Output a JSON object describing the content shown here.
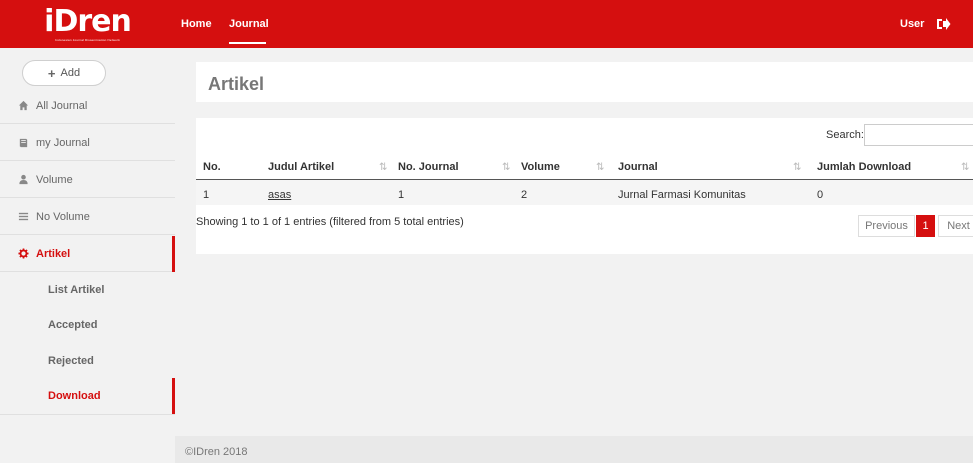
{
  "brand": {
    "logo_text": "iDren",
    "logo_subtitle": "Indonesian Journal Dissemination Network"
  },
  "topnav": {
    "home": "Home",
    "journal": "Journal",
    "user": "User"
  },
  "sidebar": {
    "add_label": "Add",
    "items": [
      {
        "label": "All Journal",
        "icon": "home-icon"
      },
      {
        "label": "my Journal",
        "icon": "book-icon"
      },
      {
        "label": "Volume",
        "icon": "user-icon"
      },
      {
        "label": "No Volume",
        "icon": "list-icon"
      },
      {
        "label": "Artikel",
        "icon": "gear-icon"
      }
    ],
    "subitems": [
      "List Artikel",
      "Accepted",
      "Rejected",
      "Download"
    ]
  },
  "main": {
    "title": "Artikel",
    "search_label": "Search:",
    "search_value": "",
    "columns": [
      "No.",
      "Judul Artikel",
      "No. Journal",
      "Volume",
      "Journal",
      "Jumlah Download"
    ],
    "rows": [
      {
        "no": "1",
        "judul": "asas",
        "no_journal": "1",
        "volume": "2",
        "journal": "Jurnal Farmasi Komunitas",
        "jumlah": "0"
      }
    ],
    "info": "Showing 1 to 1 of 1 entries (filtered from 5 total entries)",
    "pagination": {
      "previous": "Previous",
      "current": "1",
      "next": "Next"
    }
  },
  "footer": {
    "text": "©IDren 2018"
  },
  "colors": {
    "accent": "#d50f0f",
    "background": "#f2f2f2"
  }
}
